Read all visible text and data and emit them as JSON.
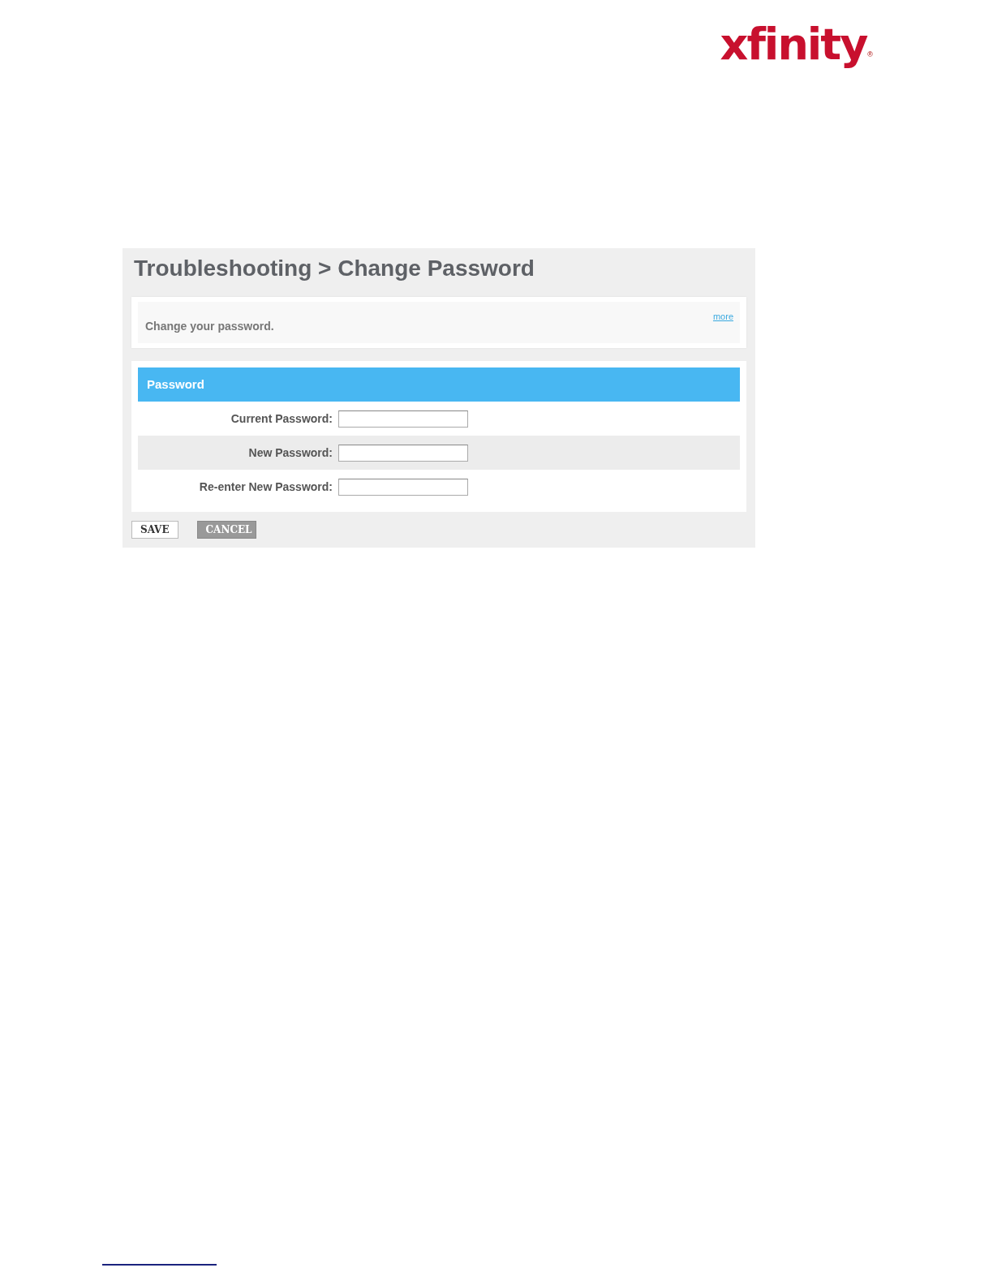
{
  "logo": {
    "text": "xfinity",
    "mark": "®"
  },
  "panel": {
    "title": "Troubleshooting > Change Password",
    "info": {
      "text": "Change your password.",
      "link": "more"
    },
    "section": {
      "heading": "Password",
      "fields": [
        {
          "label": "Current Password:"
        },
        {
          "label": "New Password:"
        },
        {
          "label": "Re-enter New Password:"
        }
      ]
    },
    "buttons": [
      {
        "label": "SAVE",
        "kind": "outline"
      },
      {
        "label": "CANCEL",
        "kind": "filled"
      }
    ]
  }
}
